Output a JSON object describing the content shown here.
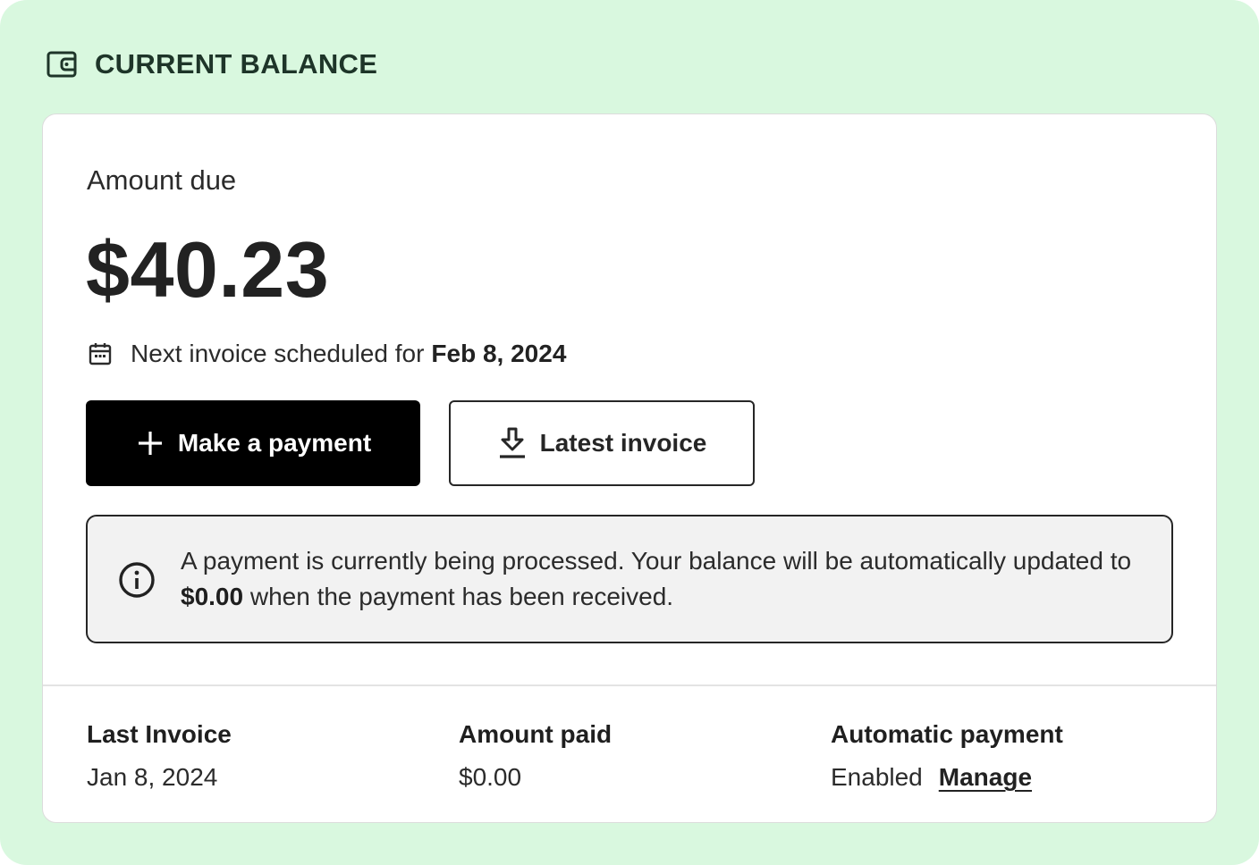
{
  "header": {
    "icon": "wallet-icon",
    "title": "CURRENT BALANCE"
  },
  "balance": {
    "amount_label": "Amount due",
    "amount_value": "$40.23",
    "next_invoice_prefix": "Next invoice scheduled for",
    "next_invoice_date": "Feb 8, 2024"
  },
  "actions": {
    "make_payment_label": "Make a payment",
    "latest_invoice_label": "Latest invoice"
  },
  "notice": {
    "text_before": "A payment is currently being processed. Your balance will be automatically updated to ",
    "amount": "$0.00",
    "text_after": " when the payment has been received."
  },
  "summary": {
    "last_invoice_label": "Last Invoice",
    "last_invoice_value": "Jan 8, 2024",
    "amount_paid_label": "Amount paid",
    "amount_paid_value": "$0.00",
    "auto_payment_label": "Automatic payment",
    "auto_payment_value": "Enabled",
    "manage_label": "Manage"
  },
  "colors": {
    "panel_bg": "#d9f8df",
    "primary_button": "#000000",
    "notice_bg": "#f2f2f2"
  }
}
